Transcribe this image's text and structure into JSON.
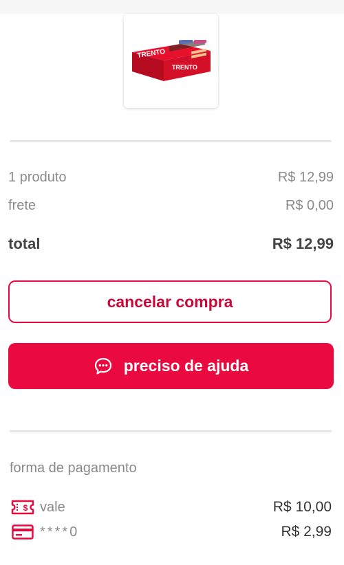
{
  "product": {
    "image_icon": "trento-chocolate-box-icon",
    "box_brand_text": "TRENTO"
  },
  "summary": {
    "products_label": "1 produto",
    "products_value": "R$ 12,99",
    "shipping_label": "frete",
    "shipping_value": "R$ 0,00",
    "total_label": "total",
    "total_value": "R$ 12,99"
  },
  "actions": {
    "cancel_label": "cancelar compra",
    "help_label": "preciso de ajuda",
    "help_icon": "chat-bubble-icon"
  },
  "payment": {
    "title": "forma de pagamento",
    "methods": [
      {
        "icon": "voucher-icon",
        "name": "vale",
        "value": "R$ 10,00"
      },
      {
        "icon": "credit-card-icon",
        "name": "****0",
        "value": "R$ 2,99"
      }
    ]
  },
  "colors": {
    "accent": "#ea0a40",
    "accent_text": "#c70a3a",
    "muted_text": "#8a8a8a",
    "divider": "#e6e6e6"
  }
}
